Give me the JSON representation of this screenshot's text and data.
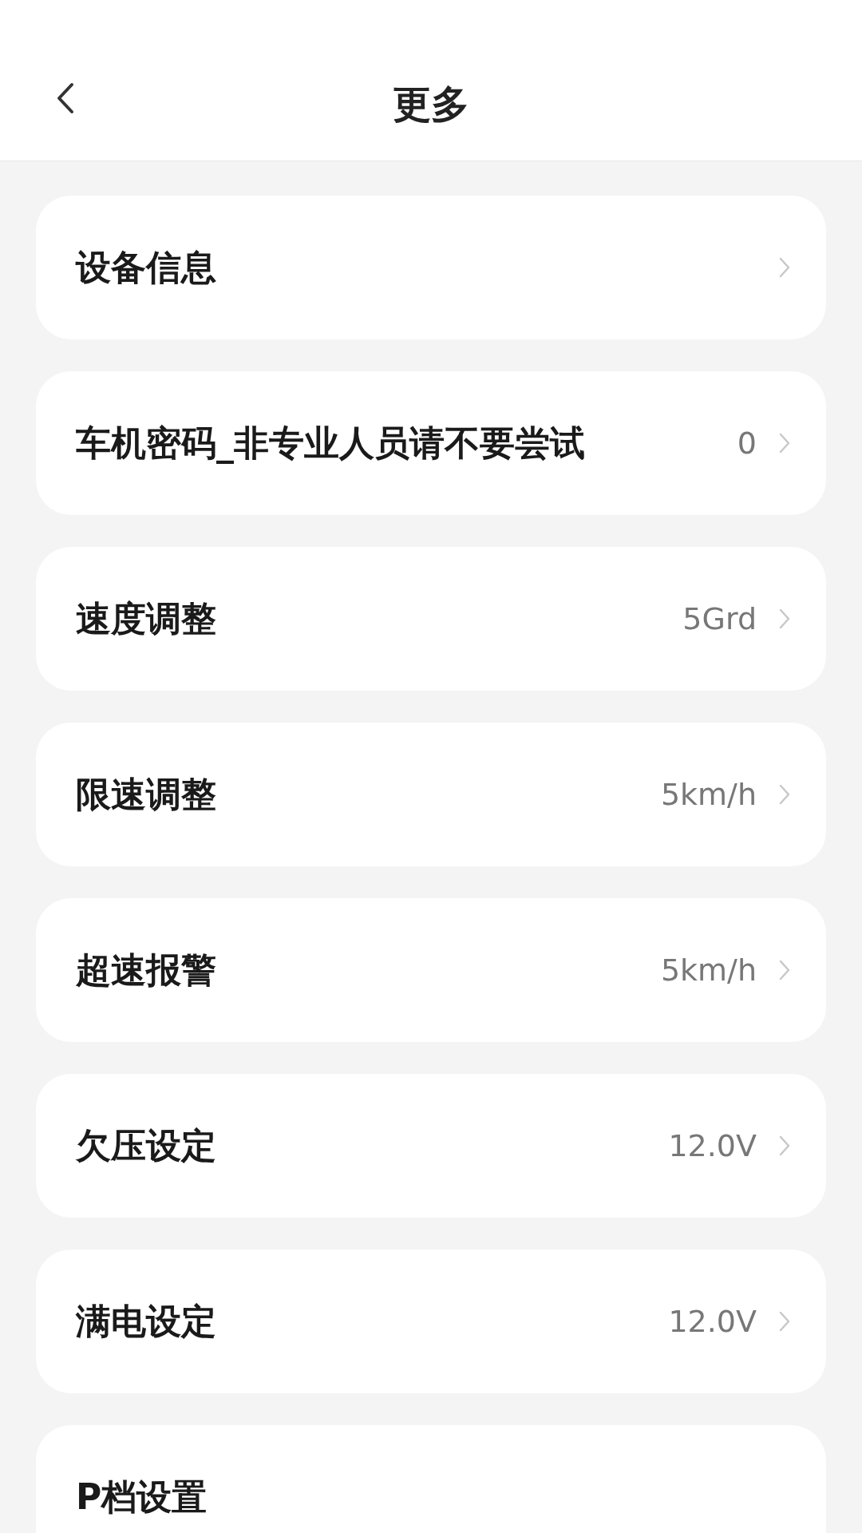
{
  "header": {
    "title": "更多"
  },
  "rows": [
    {
      "label": "设备信息"
    },
    {
      "label": "车机密码_非专业人员请不要尝试",
      "value": "0"
    },
    {
      "label": "速度调整",
      "value": "5Grd"
    },
    {
      "label": "限速调整",
      "value": "5km/h"
    },
    {
      "label": "超速报警",
      "value": "5km/h"
    },
    {
      "label": "欠压设定",
      "value": "12.0V"
    },
    {
      "label": "满电设定",
      "value": "12.0V"
    },
    {
      "label": "P档设置"
    }
  ]
}
